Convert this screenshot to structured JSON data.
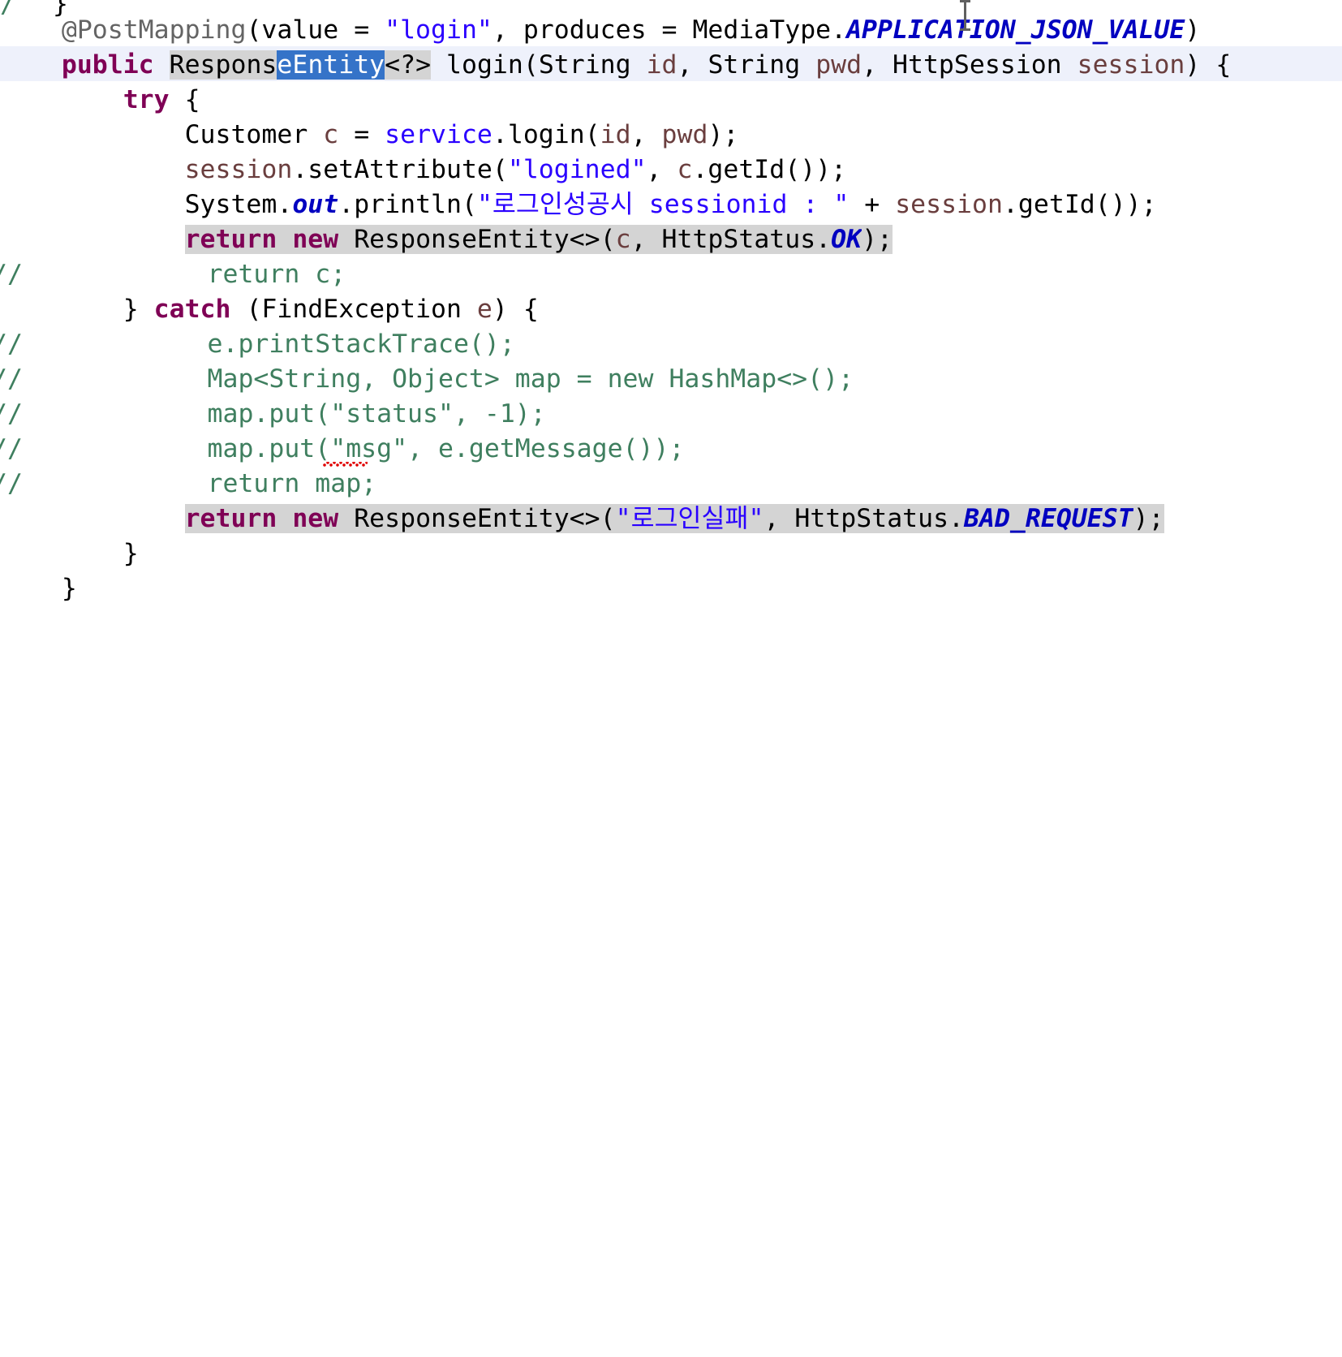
{
  "editor": {
    "language": "java",
    "font_size_px": 31.5,
    "line_height_px": 43.2,
    "background": "#ffffff",
    "current_line_background": "#eef1fb",
    "occurrence_highlight_background": "#d4d4d4",
    "selection_background": "#3573c8",
    "selection_foreground": "#ffffff",
    "colors": {
      "keyword": "#7f0055",
      "string": "#2a00ff",
      "comment": "#3f7f5f",
      "annotation": "#646464",
      "static_field": "#0000c0",
      "parameter": "#6a3e3e",
      "plain": "#000000",
      "error_squiggle": "#e00000"
    },
    "selected_text": "eEntity",
    "occurrence_word": "ResponseEntity",
    "error_marker_word": "msg",
    "cursor_icon": "text-ibeam-cursor"
  },
  "code": {
    "line_00": {
      "slash": "/",
      "brace": "}"
    },
    "line_01": {
      "indent": "    ",
      "annotation": "@PostMapping",
      "paren_open": "(",
      "attr1": "value = ",
      "str1": "\"login\"",
      "comma": ", ",
      "attr2": "produces = MediaType.",
      "const1": "APPLICATION_JSON_VALUE",
      "paren_close": ")"
    },
    "line_02": {
      "indent": "    ",
      "kw_public": "public",
      "space": " ",
      "type_prefix": "Respons",
      "type_selected": "eEntity",
      "generic": "<?>",
      "rest_a": " login(String ",
      "p_id": "id",
      "rest_b": ", String ",
      "p_pwd": "pwd",
      "rest_c": ", HttpSession ",
      "p_session": "session",
      "rest_d": ") {"
    },
    "line_03": {
      "indent": "        ",
      "kw_try": "try",
      "rest": " {"
    },
    "line_04": {
      "indent": "            ",
      "type": "Customer ",
      "var": "c",
      "eq": " = ",
      "svc": "service",
      "call": ".login(",
      "a1": "id",
      "comma": ", ",
      "a2": "pwd",
      "end": ");"
    },
    "line_05": {
      "indent": "            ",
      "obj": "session",
      "call": ".setAttribute(",
      "str": "\"logined\"",
      "mid": ", ",
      "var": "c",
      "end": ".getId());"
    },
    "line_06": {
      "indent": "            ",
      "sys": "System.",
      "out": "out",
      "call": ".println(",
      "str": "\"로그인성공시 sessionid : \"",
      "plus": " + ",
      "obj": "session",
      "end": ".getId());"
    },
    "line_07": {
      "indent": "            ",
      "kw_return": "return",
      "sp": " ",
      "kw_new": "new",
      "type": " ResponseEntity<>(",
      "var": "c",
      "comma": ", ",
      "status": "HttpStatus.",
      "const": "OK",
      "end": ");"
    },
    "line_08": {
      "comment_prefix": "//",
      "indent": "            ",
      "text": "return c;"
    },
    "line_09": {
      "indent": "        ",
      "brace": "} ",
      "kw_catch": "catch",
      "rest_a": " (FindException ",
      "p_e": "e",
      "rest_b": ") {"
    },
    "line_10": {
      "comment_prefix": "//",
      "indent": "            ",
      "text": "e.printStackTrace();"
    },
    "line_11": {
      "comment_prefix": "//",
      "indent": "            ",
      "text": "Map<String, Object> map = new HashMap<>();"
    },
    "line_12": {
      "comment_prefix": "//",
      "indent": "            ",
      "text": "map.put(\"status\", -1);"
    },
    "line_13": {
      "comment_prefix": "//",
      "indent": "            ",
      "text": "map.put(\"msg\", e.getMessage());"
    },
    "line_14": {
      "comment_prefix": "//",
      "indent": "            ",
      "text": "return map;"
    },
    "line_15": {
      "indent": "            ",
      "kw_return": "return",
      "sp": " ",
      "kw_new": "new",
      "type": " ResponseEntity<>(",
      "str": "\"로그인실패\"",
      "comma": ", ",
      "status": "HttpStatus.",
      "const": "BAD_REQUEST",
      "end": ");"
    },
    "line_16": {
      "indent": "        ",
      "brace": "}"
    },
    "line_17": {
      "indent": "    ",
      "brace": "}"
    }
  }
}
